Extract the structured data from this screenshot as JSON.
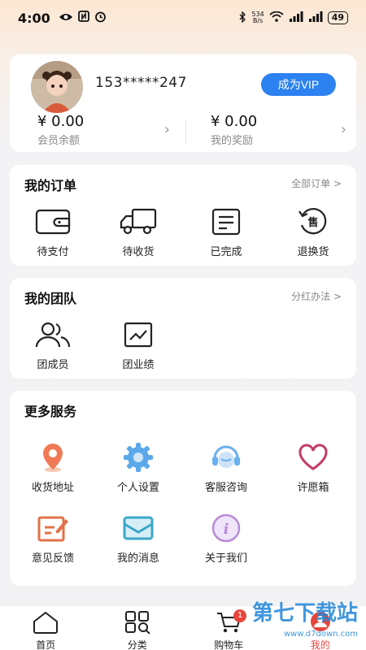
{
  "status_bar": {
    "time": "4:00",
    "net_speed_value": "534",
    "net_speed_unit": "B/s",
    "battery": "49"
  },
  "profile": {
    "phone": "153*****247",
    "vip_button": "成为VIP",
    "balance": {
      "amount": "¥ 0.00",
      "label": "会员余额"
    },
    "reward": {
      "amount": "¥ 0.00",
      "label": "我的奖励"
    }
  },
  "orders": {
    "title": "我的订单",
    "link": "全部订单 >",
    "items": [
      {
        "label": "待支付",
        "icon": "wallet-icon"
      },
      {
        "label": "待收货",
        "icon": "truck-icon"
      },
      {
        "label": "已完成",
        "icon": "completed-list-icon"
      },
      {
        "label": "退换货",
        "icon": "return-icon",
        "glyph": "售"
      }
    ]
  },
  "team": {
    "title": "我的团队",
    "link": "分红办法 >",
    "items": [
      {
        "label": "团成员",
        "icon": "members-icon"
      },
      {
        "label": "团业绩",
        "icon": "performance-chart-icon"
      }
    ]
  },
  "services": {
    "title": "更多服务",
    "items": [
      {
        "label": "收货地址",
        "icon": "location-pin-icon",
        "color": "#f07a55"
      },
      {
        "label": "个人设置",
        "icon": "gear-icon",
        "color": "#5aa8e8"
      },
      {
        "label": "客服咨询",
        "icon": "customer-service-icon",
        "color": "#6ab0ee"
      },
      {
        "label": "许愿箱",
        "icon": "heart-icon",
        "color": "#c23c6a"
      },
      {
        "label": "意见反馈",
        "icon": "feedback-edit-icon",
        "color": "#e0714a"
      },
      {
        "label": "我的消息",
        "icon": "message-envelope-icon",
        "color": "#3aa7c9"
      },
      {
        "label": "关于我们",
        "icon": "info-icon",
        "glyph": "i",
        "color": "#b98ad8"
      }
    ]
  },
  "tabs": [
    {
      "label": "首页",
      "icon": "home-icon"
    },
    {
      "label": "分类",
      "icon": "category-grid-icon"
    },
    {
      "label": "购物车",
      "icon": "cart-icon",
      "badge": "1"
    },
    {
      "label": "我的",
      "icon": "profile-icon"
    }
  ],
  "watermark": {
    "text": "第七下载站",
    "url": "www.d7down.com"
  }
}
